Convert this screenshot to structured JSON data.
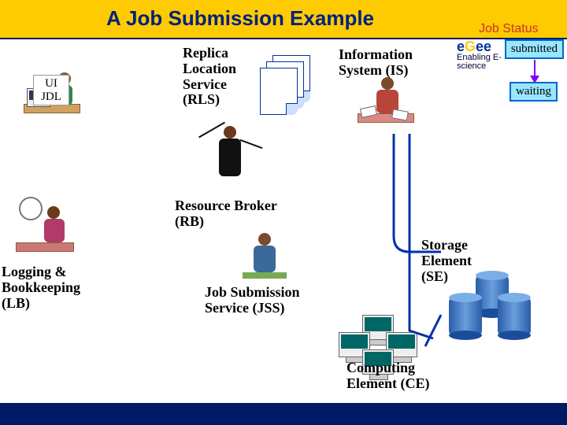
{
  "title": "A Job Submission Example",
  "job_status_label": "Job Status",
  "statuses": {
    "s1": "submitted",
    "s2": "waiting"
  },
  "labels": {
    "ui": "UI\nJDL",
    "rls": "Replica Location Service (RLS)",
    "is": "Information System (IS)",
    "rb": "Resource Broker (RB)",
    "lb": "Logging & Bookkeeping (LB)",
    "jss": "Job Submission Service (JSS)",
    "se": "Storage Element (SE)",
    "ce": "Computing Element (CE)"
  },
  "brand": {
    "name": "eGee",
    "tag": "Enabling E-science"
  }
}
